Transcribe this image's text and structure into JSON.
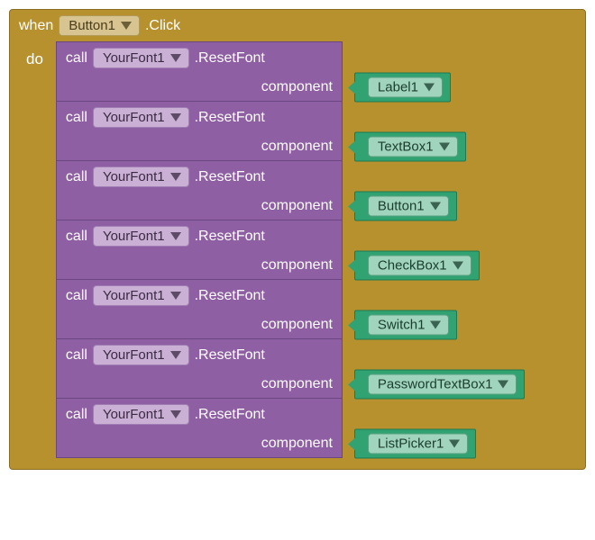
{
  "event": {
    "when": "when",
    "target": "Button1",
    "eventName": ".Click",
    "do": "do"
  },
  "calls": [
    {
      "call": "call",
      "obj": "YourFont1",
      "method": ".ResetFont",
      "argLabel": "component",
      "argValue": "Label1"
    },
    {
      "call": "call",
      "obj": "YourFont1",
      "method": ".ResetFont",
      "argLabel": "component",
      "argValue": "TextBox1"
    },
    {
      "call": "call",
      "obj": "YourFont1",
      "method": ".ResetFont",
      "argLabel": "component",
      "argValue": "Button1"
    },
    {
      "call": "call",
      "obj": "YourFont1",
      "method": ".ResetFont",
      "argLabel": "component",
      "argValue": "CheckBox1"
    },
    {
      "call": "call",
      "obj": "YourFont1",
      "method": ".ResetFont",
      "argLabel": "component",
      "argValue": "Switch1"
    },
    {
      "call": "call",
      "obj": "YourFont1",
      "method": ".ResetFont",
      "argLabel": "component",
      "argValue": "PasswordTextBox1"
    },
    {
      "call": "call",
      "obj": "YourFont1",
      "method": ".ResetFont",
      "argLabel": "component",
      "argValue": "ListPicker1"
    }
  ]
}
